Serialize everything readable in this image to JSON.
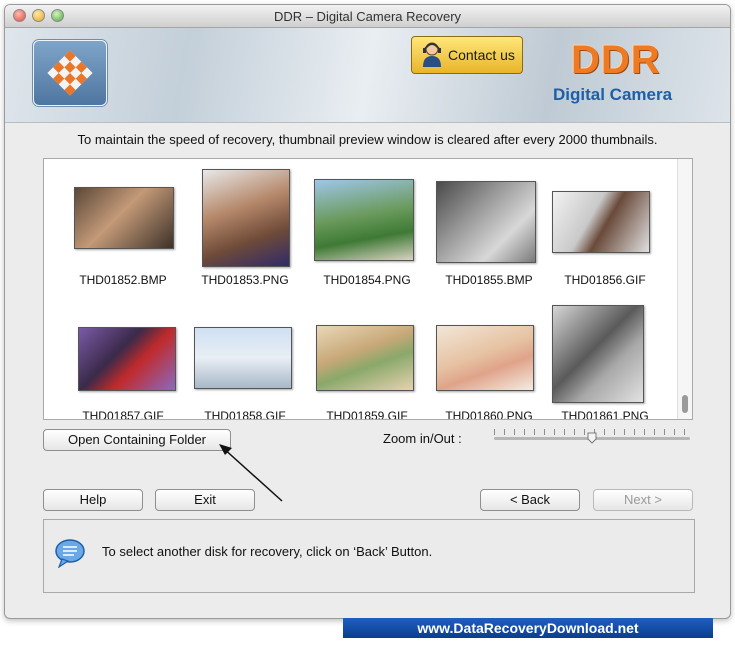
{
  "window": {
    "title": "DDR – Digital Camera Recovery"
  },
  "header": {
    "contact_label": "Contact us",
    "brand_title": "DDR",
    "brand_subtitle": "Digital Camera"
  },
  "notice": "To maintain the speed of recovery, thumbnail preview window is cleared after every 2000 thumbnails.",
  "thumbnails": [
    {
      "name": "THD01852.BMP"
    },
    {
      "name": "THD01853.PNG"
    },
    {
      "name": "THD01854.PNG"
    },
    {
      "name": "THD01855.BMP"
    },
    {
      "name": "THD01856.GIF"
    },
    {
      "name": "THD01857.GIF"
    },
    {
      "name": "THD01858.GIF"
    },
    {
      "name": "THD01859.GIF"
    },
    {
      "name": "THD01860.PNG"
    },
    {
      "name": "THD01861.PNG"
    }
  ],
  "controls": {
    "open_folder_label": "Open Containing Folder",
    "zoom_label": "Zoom in/Out :",
    "zoom_value": 0.5
  },
  "buttons": {
    "help": "Help",
    "exit": "Exit",
    "back": "< Back",
    "next": "Next >"
  },
  "message": "To select another disk for recovery, click on ‘Back’ Button.",
  "footer": {
    "url": "www.DataRecoveryDownload.net"
  },
  "colors": {
    "brand_orange": "#ef7a24",
    "brand_blue": "#1e5fa8",
    "footer_blue": "#0b3d8f",
    "contact_gold": "#e8b52a"
  }
}
